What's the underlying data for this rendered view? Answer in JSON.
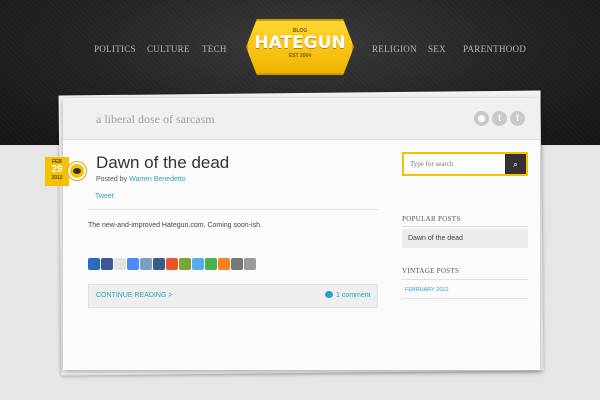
{
  "nav": {
    "left": [
      "POLITICS",
      "CULTURE",
      "TECH"
    ],
    "right": [
      "RELIGION",
      "SEX",
      "PARENTHOOD"
    ]
  },
  "logo": {
    "blog": "BLOG",
    "name": "HATEGUN",
    "est": "EST 2004"
  },
  "tagline": "a liberal dose of sarcasm",
  "social_icons": [
    "rss-icon",
    "twitter-icon",
    "facebook-icon"
  ],
  "post": {
    "date": {
      "month": "FEB",
      "day": "29",
      "year": "2012"
    },
    "title": "Dawn of the dead",
    "posted_by_label": "Posted by",
    "author": "Warren Benedetto",
    "tweet": "Tweet",
    "body": "The new-and-improved Hategun.com. Coming soon-ish.",
    "share_colors": [
      "#2a6bbf",
      "#3b5998",
      "#e2e2e2",
      "#4b8bf5",
      "#7aa0c0",
      "#3a5a8a",
      "#e9542b",
      "#7ba43a",
      "#55acee",
      "#4caf50",
      "#f58220",
      "#777777",
      "#999999"
    ],
    "continue_reading": "CONTINUE READING >",
    "comments": "1 comment"
  },
  "sidebar": {
    "search_placeholder": "Type for search",
    "popular_heading": "POPULAR POSTS",
    "popular_items": [
      "Dawn of the dead"
    ],
    "vintage_heading": "VINTAGE POSTS",
    "vintage_items": [
      "FEBRUARY 2012"
    ]
  },
  "colors": {
    "accent": "#f2c200",
    "link": "#2a9fc8",
    "header": "#222222"
  }
}
